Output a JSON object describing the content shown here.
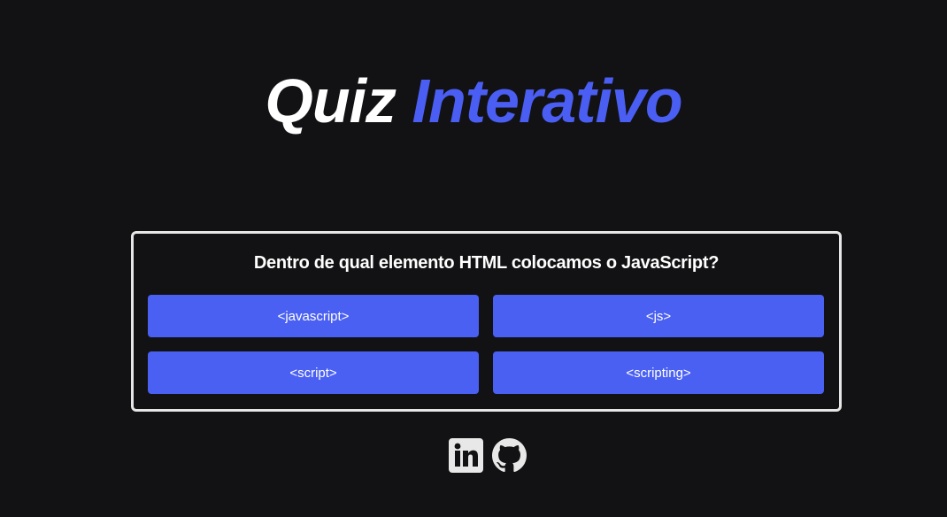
{
  "header": {
    "title_part1": "Quiz",
    "title_part2": "Interativo"
  },
  "quiz": {
    "question": "Dentro de qual elemento HTML colocamos o JavaScript?",
    "answers": [
      {
        "label": "<javascript>"
      },
      {
        "label": "<js>"
      },
      {
        "label": "<script>"
      },
      {
        "label": "<scripting>"
      }
    ]
  },
  "footer": {
    "icons": [
      "linkedin-icon",
      "github-icon"
    ]
  },
  "colors": {
    "background": "#121214",
    "accent": "#4a5ef3",
    "button": "#4a60f2",
    "card_border": "#e6e6e6"
  }
}
